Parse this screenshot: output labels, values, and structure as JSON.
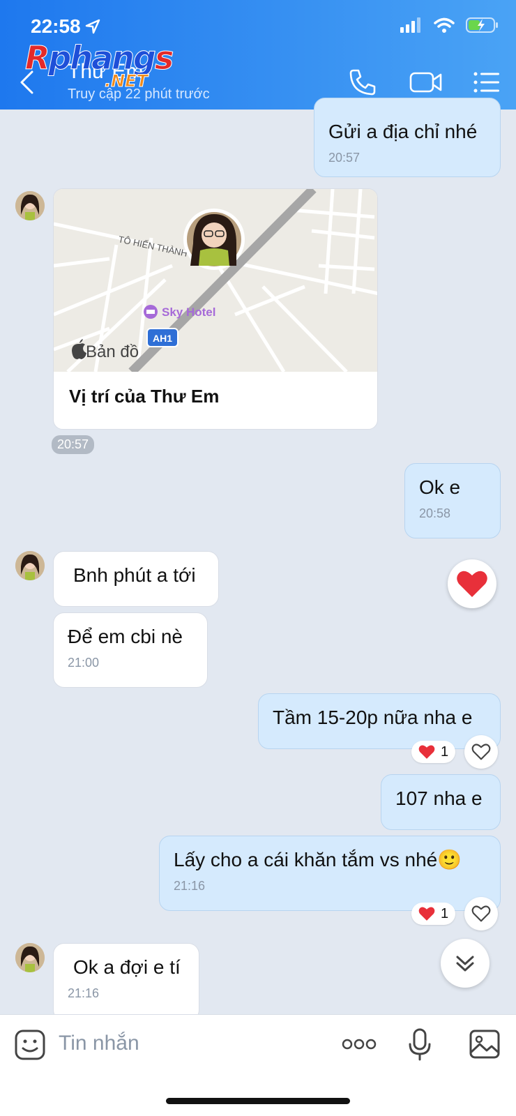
{
  "status": {
    "time": "22:58"
  },
  "watermark": {
    "line1": "Rphangs",
    "line2": ".NET"
  },
  "header": {
    "contact_name": "Thư Em",
    "last_seen": "Truy cập 22 phút trước"
  },
  "messages": {
    "m1": {
      "text": "Gửi a địa chỉ nhé",
      "time": "20:57"
    },
    "map": {
      "street": "TÔ HIẾN THÀNH",
      "poi": "Sky Hotel",
      "road_shield": "AH1",
      "maps_label": "Bản đồ",
      "caption": "Vị trí của Thư Em",
      "time": "20:57"
    },
    "m2": {
      "text": "Ok e",
      "time": "20:58"
    },
    "m3": {
      "text": "Bnh phút a tới"
    },
    "m4": {
      "text": "Để em cbi nè",
      "time": "21:00"
    },
    "m5": {
      "text": "Tầm 15-20p nữa nha e",
      "reaction_count": "1"
    },
    "m6": {
      "text": "107 nha e"
    },
    "m7": {
      "text": "Lấy cho a cái khăn tắm vs nhé🙂",
      "time": "21:16",
      "reaction_count": "1"
    },
    "m8": {
      "text": "Ok a đợi e tí",
      "time": "21:16"
    }
  },
  "input": {
    "placeholder": "Tin nhắn"
  },
  "colors": {
    "header_start": "#1e78ee",
    "header_end": "#4aa3f5",
    "out_bubble": "#d5eafd",
    "heart": "#e8303a"
  }
}
